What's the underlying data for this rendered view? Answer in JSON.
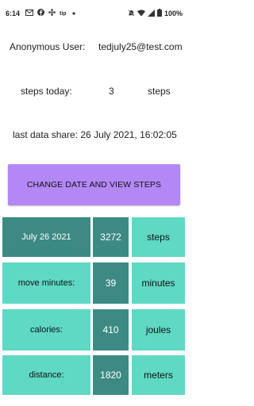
{
  "status_bar": {
    "time": "6:14",
    "battery": "100%",
    "icons": [
      "gmail-icon",
      "facebook-icon",
      "cbc-icon",
      "tip-icon",
      "dot-icon",
      "mute-icon",
      "wifi-icon",
      "signal-icon",
      "battery-icon"
    ]
  },
  "user": {
    "label": "Anonymous User:",
    "email": "tedjuly25@test.com"
  },
  "steps_today": {
    "label": "steps today:",
    "value": "3",
    "unit": "steps"
  },
  "last_share": {
    "text": "last data share: 26 July 2021, 16:02:05"
  },
  "button": {
    "label": "CHANGE DATE AND VIEW STEPS"
  },
  "colors": {
    "button": "#b388f5",
    "teal": "#5fd8c4",
    "dark_teal": "#3d8a84"
  },
  "table": {
    "rows": [
      {
        "label": "July 26 2021",
        "value": "3272",
        "unit": "steps"
      },
      {
        "label": "move minutes:",
        "value": "39",
        "unit": "minutes"
      },
      {
        "label": "calories:",
        "value": "410",
        "unit": "joules"
      },
      {
        "label": "distance:",
        "value": "1820",
        "unit": "meters"
      }
    ]
  }
}
